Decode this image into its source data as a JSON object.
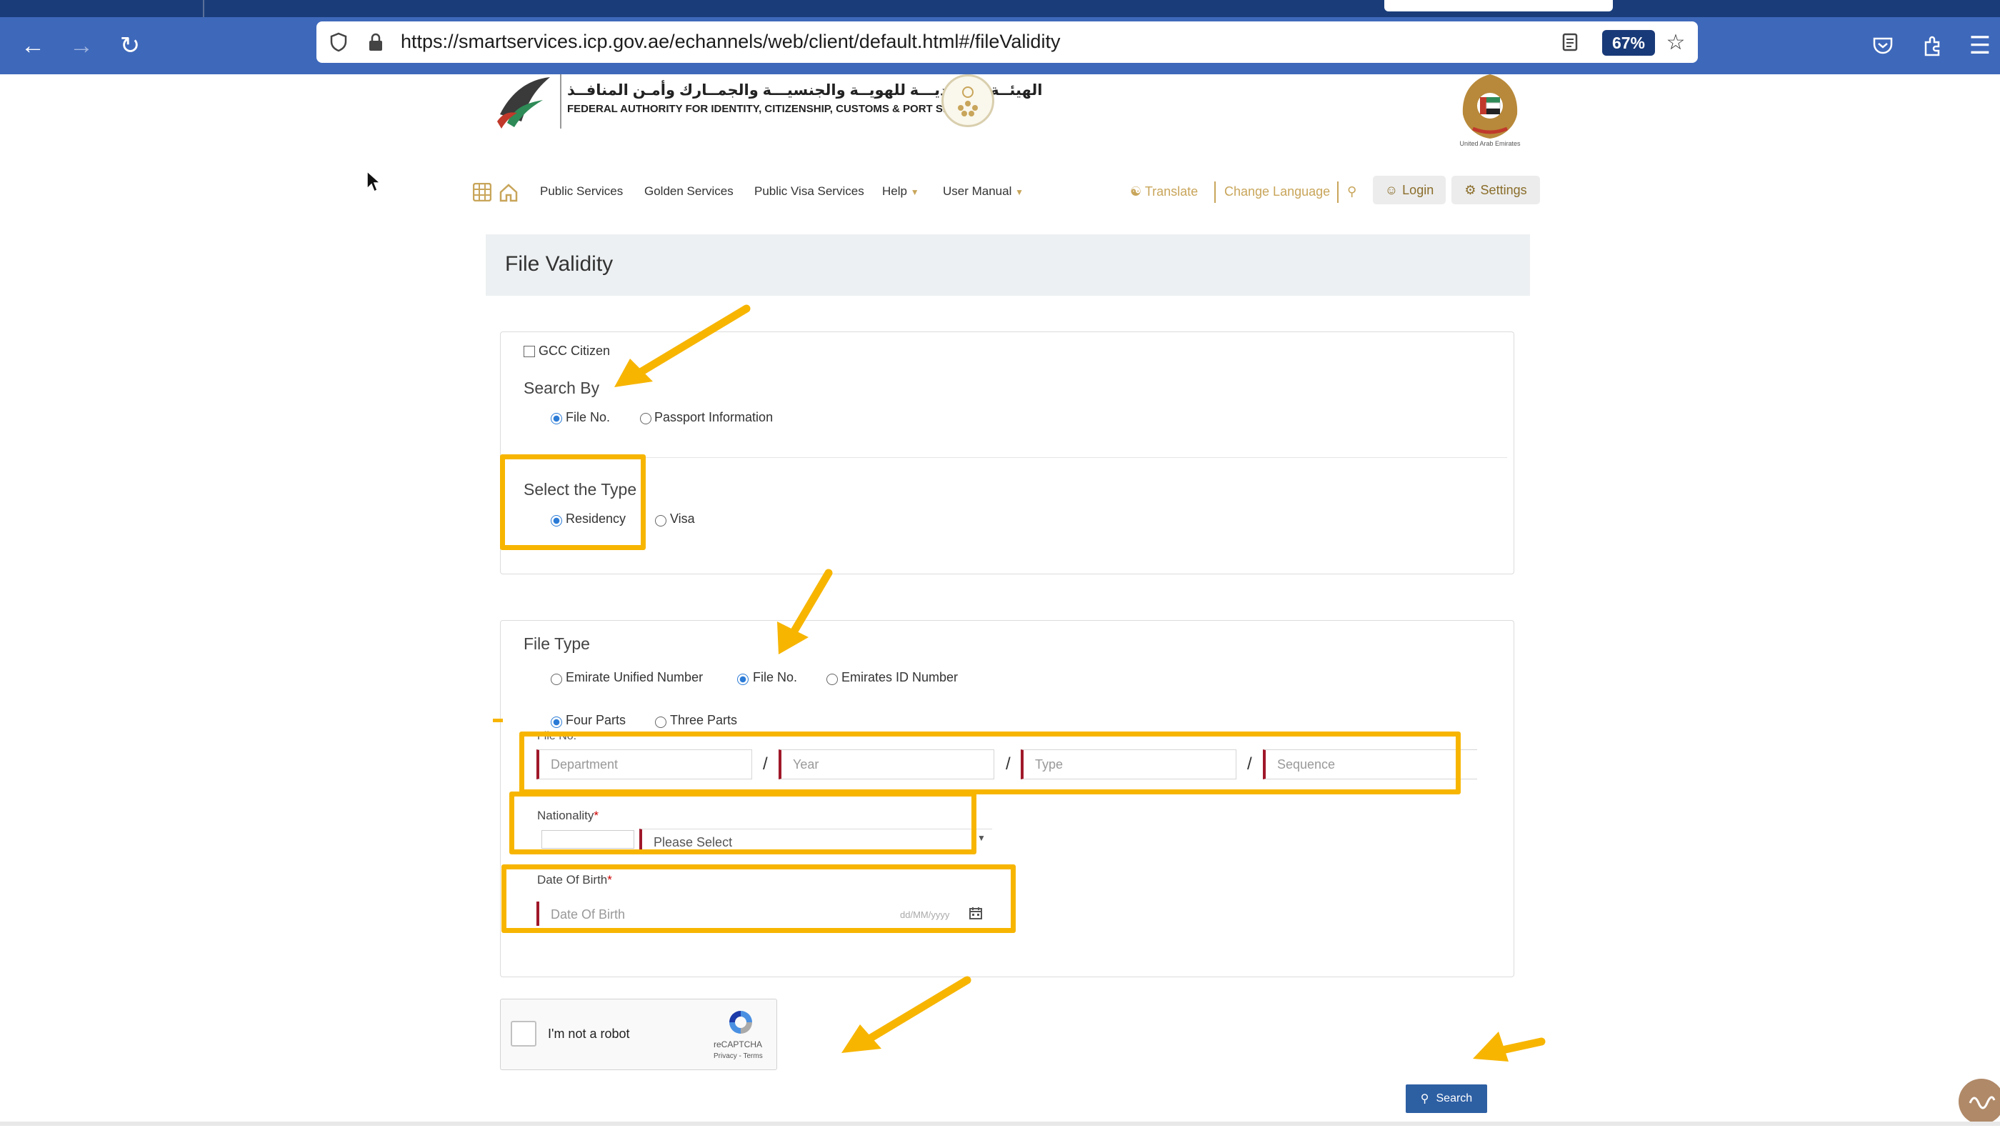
{
  "browser": {
    "url": "https://smartservices.icp.gov.ae/echannels/web/client/default.html#/fileValidity",
    "zoom": "67%",
    "icons": [
      "back-icon",
      "forward-icon",
      "reload-icon",
      "shield-icon",
      "lock-icon",
      "reader-view-icon",
      "bookmark-star-icon",
      "pocket-icon",
      "extensions-icon",
      "menu-icon"
    ]
  },
  "header": {
    "authority_ar": "الهيئــة الاتحاديـــة للهويــة والجنسيـــة والجمــارك وأمـن المنافــذ",
    "authority_en": "FEDERAL AUTHORITY FOR IDENTITY, CITIZENSHIP, CUSTOMS & PORT SECURITY",
    "emblem_caption": "United Arab Emirates"
  },
  "nav": {
    "items": [
      "Public Services",
      "Golden Services",
      "Public Visa Services",
      "Help",
      "User Manual"
    ],
    "translate": "Translate",
    "change_language": "Change Language",
    "login": "Login",
    "settings": "Settings"
  },
  "page": {
    "title": "File Validity"
  },
  "form": {
    "gcc_citizen": "GCC Citizen",
    "search_by": "Search By",
    "search_by_options": [
      "File No.",
      "Passport Information"
    ],
    "search_by_selected": "File No.",
    "select_type": "Select the Type",
    "type_options": [
      "Residency",
      "Visa"
    ],
    "type_selected": "Residency",
    "file_type": "File Type",
    "file_type_options": [
      "Emirate Unified Number",
      "File No.",
      "Emirates ID Number"
    ],
    "file_type_selected": "File No.",
    "parts_options": [
      "Four Parts",
      "Three Parts"
    ],
    "parts_selected": "Four Parts",
    "file_no_label": "File No.",
    "file_no_placeholders": [
      "Department",
      "Year",
      "Type",
      "Sequence"
    ],
    "nationality_label": "Nationality",
    "nationality_placeholder": "Please Select",
    "dob_label": "Date Of Birth",
    "dob_placeholder": "Date Of Birth",
    "dob_format": "dd/MM/yyyy",
    "required_mark": "*"
  },
  "captcha": {
    "label": "I'm not a robot",
    "brand": "reCAPTCHA",
    "links": "Privacy - Terms"
  },
  "actions": {
    "search": "Search"
  },
  "colors": {
    "browser_bar": "#3e68ba",
    "highlight": "#f7b500",
    "accent_gold": "#c8a55a",
    "required_red": "#a0182a",
    "search_button": "#2d5fa3"
  }
}
